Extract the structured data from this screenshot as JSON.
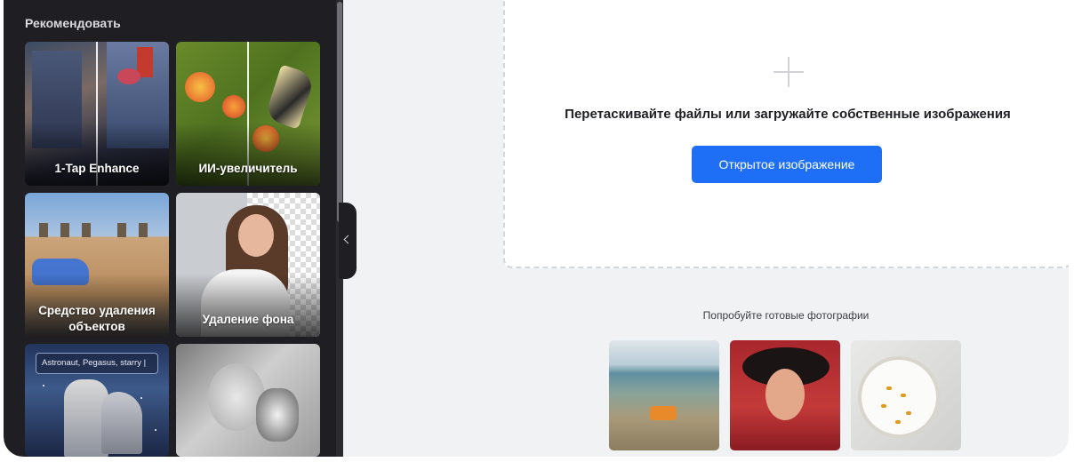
{
  "sidebar": {
    "title": "Рекомендовать",
    "tools": [
      {
        "label": "1-Tap Enhance",
        "icon": "street-photo-thumbnail"
      },
      {
        "label": "ИИ-увеличитель",
        "icon": "butterfly-flower-thumbnail"
      },
      {
        "label": "Средство удаления объектов",
        "icon": "building-car-thumbnail"
      },
      {
        "label": "Удаление фона",
        "icon": "woman-portrait-thumbnail"
      },
      {
        "label": "",
        "icon": "astronaut-pegasus-thumbnail",
        "prompt": "Astronaut, Pegasus, starry |"
      },
      {
        "label": "",
        "icon": "bw-woman-dog-thumbnail"
      }
    ]
  },
  "upload": {
    "title": "Перетаскивайте файлы или загружайте собственные изображения",
    "button": "Открытое изображение",
    "icon": "plus-icon"
  },
  "samples": {
    "title": "Попробуйте готовые фотографии",
    "items": [
      {
        "icon": "car-landscape-photo"
      },
      {
        "icon": "woman-hat-photo"
      },
      {
        "icon": "food-plate-photo"
      }
    ]
  },
  "colors": {
    "sidebar_bg": "#1f1f23",
    "accent": "#1e6ff5",
    "page_bg": "#f1f2f4"
  }
}
